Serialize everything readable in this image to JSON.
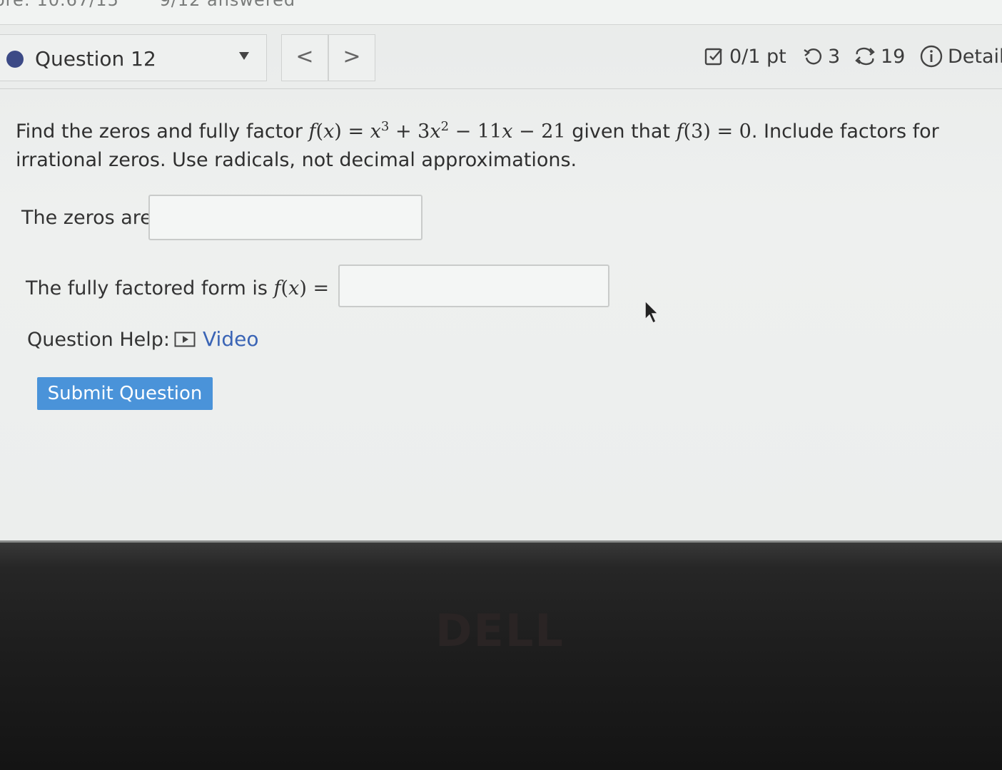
{
  "top_strip": {
    "score_text": "ore: 10.67/15",
    "answered_text": "9/12 answered"
  },
  "question_nav": {
    "question_label": "Question 12",
    "prev_symbol": "<",
    "next_symbol": ">"
  },
  "meta": {
    "score": "0/1 pt",
    "retries": "3",
    "attempts": "19",
    "details_label": "Detail"
  },
  "question": {
    "intro": "Find the zeros and fully factor",
    "func_name": "f",
    "var": "x",
    "term1_base": "x",
    "term1_exp": "3",
    "op1": "+",
    "term2_coef": "3",
    "term2_base": "x",
    "term2_exp": "2",
    "op2": "−",
    "term3": "11",
    "term3_var": "x",
    "op3": "−",
    "term4": "21",
    "given_text": "given that",
    "given_arg": "3",
    "given_val": "0",
    "outro_line1": ". Include factors for",
    "outro_line2": "irrational zeros. Use radicals, not decimal approximations."
  },
  "answers": {
    "zeros_label": "The zeros are",
    "zeros_value": "",
    "factored_label": "The fully factored form is",
    "factored_func": "f",
    "factored_var": "x",
    "factored_value": ""
  },
  "help": {
    "label": "Question Help:",
    "video_label": "Video"
  },
  "submit_label": "Submit Question",
  "bezel": {
    "brand": "DELL"
  },
  "colors": {
    "accent_blue": "#4a93d9",
    "link_blue": "#3a64b5",
    "question_dot": "#3c4a86"
  }
}
